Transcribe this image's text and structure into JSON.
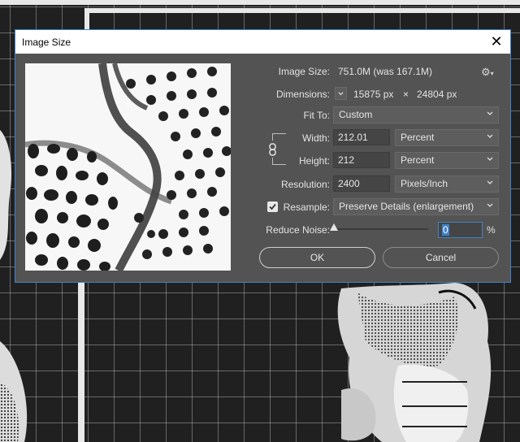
{
  "dialog": {
    "title": "Image Size",
    "close_glyph": "✕"
  },
  "image_size": {
    "label": "Image Size:",
    "value": "751.0M (was 167.1M)"
  },
  "dimensions": {
    "label": "Dimensions:",
    "width": "15875 px",
    "times": "×",
    "height": "24804 px"
  },
  "fit_to": {
    "label": "Fit To:",
    "value": "Custom"
  },
  "width": {
    "label": "Width:",
    "value": "212.01",
    "unit": "Percent"
  },
  "height": {
    "label": "Height:",
    "value": "212",
    "unit": "Percent"
  },
  "resolution": {
    "label": "Resolution:",
    "value": "2400",
    "unit": "Pixels/Inch"
  },
  "resample": {
    "label": "Resample:",
    "checked": true,
    "method": "Preserve Details (enlargement)"
  },
  "reduce_noise": {
    "label": "Reduce Noise:",
    "value": "0",
    "unit": "%",
    "level": 0
  },
  "buttons": {
    "ok": "OK",
    "cancel": "Cancel"
  },
  "icons": {
    "close": "close-icon",
    "gear": "gear-icon",
    "chevron": "chevron-down-icon",
    "chain": "chain-link-icon",
    "slider": "slider-thumb-icon"
  },
  "colors": {
    "dialog_bg": "#535353",
    "accent": "#3f82c8",
    "text": "#e3e3e3"
  }
}
